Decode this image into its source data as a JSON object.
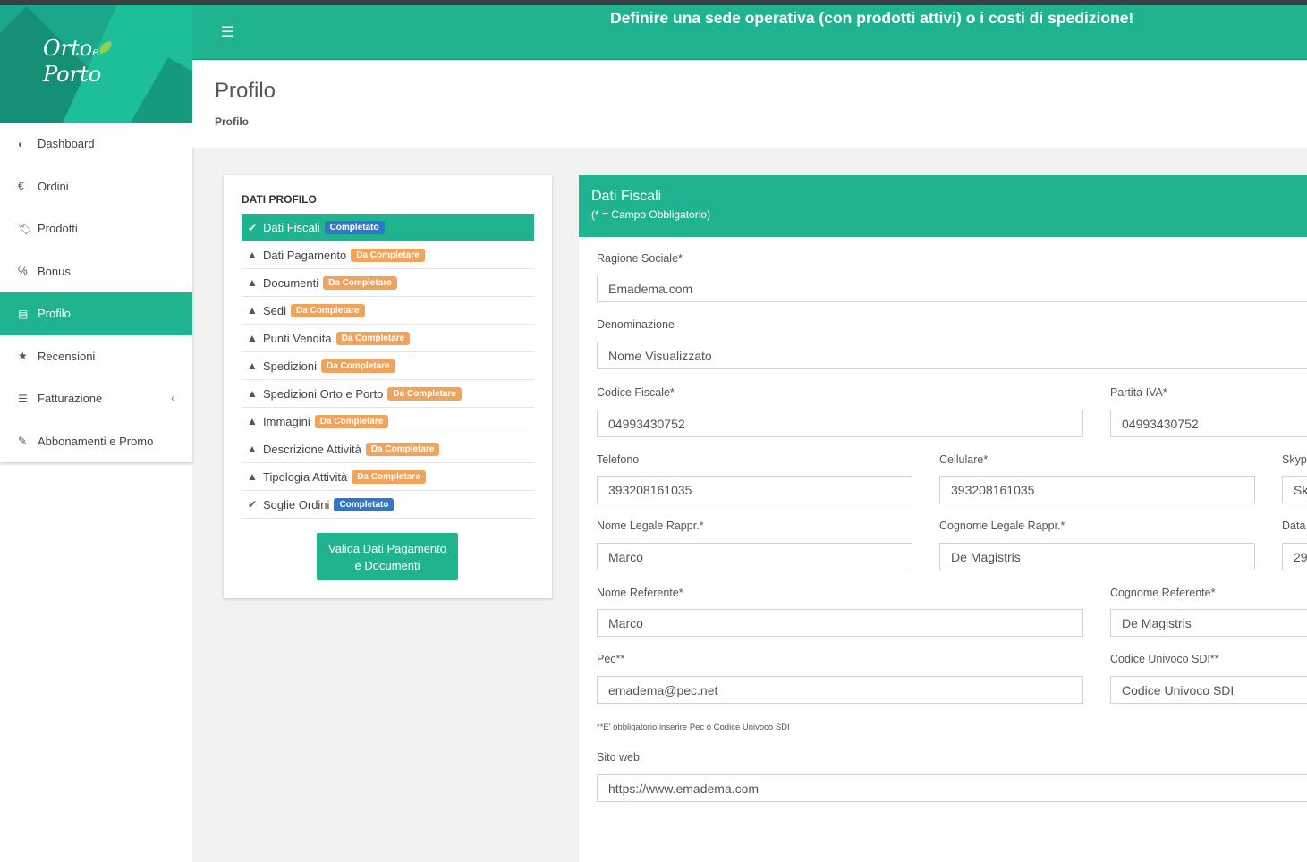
{
  "app": {
    "logo_line1": "Orto",
    "logo_e": "e",
    "logo_line2": "Porto",
    "notice": "Definire una sede operativa (con prodotti attivi) o i costi di spedizione!"
  },
  "sidebar": {
    "items": [
      {
        "label": "Dashboard",
        "icon": "dashboard-icon",
        "glyph": "◐"
      },
      {
        "label": "Ordini",
        "icon": "euro-icon",
        "glyph": "€"
      },
      {
        "label": "Prodotti",
        "icon": "tags-icon",
        "glyph": "🏷"
      },
      {
        "label": "Bonus",
        "icon": "percent-icon",
        "glyph": "%"
      },
      {
        "label": "Profilo",
        "icon": "id-card-icon",
        "glyph": "▤"
      },
      {
        "label": "Recensioni",
        "icon": "star-icon",
        "glyph": "★"
      },
      {
        "label": "Fatturazione",
        "icon": "list-icon",
        "glyph": "☰"
      },
      {
        "label": "Abbonamenti e Promo",
        "icon": "pencil-icon",
        "glyph": "✎"
      }
    ],
    "chevron": "‹"
  },
  "page": {
    "title": "Profilo",
    "breadcrumb": "Profilo"
  },
  "profile_status": {
    "title": "DATI PROFILO",
    "items": [
      {
        "label": "Dati Fiscali",
        "badge": "Completato",
        "state": "done"
      },
      {
        "label": "Dati Pagamento",
        "badge": "Da Completare",
        "state": "todo"
      },
      {
        "label": "Documenti",
        "badge": "Da Completare",
        "state": "todo"
      },
      {
        "label": "Sedi",
        "badge": "Da Completare",
        "state": "todo"
      },
      {
        "label": "Punti Vendita",
        "badge": "Da Completare",
        "state": "todo"
      },
      {
        "label": "Spedizioni",
        "badge": "Da Completare",
        "state": "todo"
      },
      {
        "label": "Spedizioni Orto e Porto",
        "badge": "Da Completare",
        "state": "todo"
      },
      {
        "label": "Immagini",
        "badge": "Da Completare",
        "state": "todo"
      },
      {
        "label": "Descrizione Attività",
        "badge": "Da Completare",
        "state": "todo"
      },
      {
        "label": "Tipologia Attività",
        "badge": "Da Completare",
        "state": "todo"
      },
      {
        "label": "Soglie Ordini",
        "badge": "Completato",
        "state": "done"
      }
    ],
    "check_glyph": "✔",
    "warn_glyph": "▲",
    "validate_line1": "Valida Dati Pagamento",
    "validate_line2": "e Documenti"
  },
  "form": {
    "title": "Dati Fiscali",
    "subtitle": "(* = Campo Obbligatorio)",
    "ragione_sociale_label": "Ragione Sociale*",
    "ragione_sociale_value": "Emadema.com",
    "denominazione_label": "Denominazione",
    "denominazione_placeholder": "Nome Visualizzato",
    "codice_fiscale_label": "Codice Fiscale*",
    "codice_fiscale_value": "04993430752",
    "partita_iva_label": "Partita IVA*",
    "partita_iva_value": "04993430752",
    "telefono_label": "Telefono",
    "telefono_value": "393208161035",
    "cellulare_label": "Cellulare*",
    "cellulare_value": "393208161035",
    "skype_label": "Skyp",
    "skype_placeholder": "Sk",
    "nome_legale_label": "Nome Legale Rappr.*",
    "nome_legale_value": "Marco",
    "cognome_legale_label": "Cognome Legale Rappr.*",
    "cognome_legale_value": "De Magistris",
    "data_label": "Data",
    "data_value": "29",
    "nome_referente_label": "Nome Referente*",
    "nome_referente_value": "Marco",
    "cognome_referente_label": "Cognome Referente*",
    "cognome_referente_value": "De Magistris",
    "pec_label": "Pec**",
    "pec_value": "emadema@pec.net",
    "sdi_label": "Codice Univoco SDI**",
    "sdi_placeholder": "Codice Univoco SDI",
    "note": "**E' obbligatorio inserire Pec o Codice Univoco SDI",
    "sito_label": "Sito web",
    "sito_value": "https://www.emadema.com"
  }
}
